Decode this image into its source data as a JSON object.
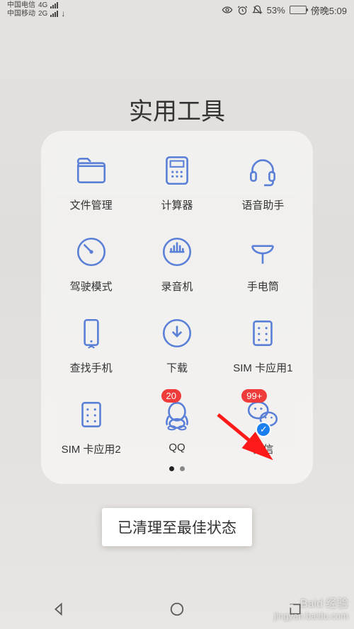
{
  "status": {
    "carrier1": "中国电信",
    "net1": "4G",
    "carrier2": "中国移动",
    "net2": "2G",
    "battery_pct": "53%",
    "time": "傍晚5:09"
  },
  "folder": {
    "title": "实用工具",
    "apps": [
      {
        "id": "files",
        "label": "文件管理",
        "icon": "folder-icon",
        "badge": null,
        "dual": false
      },
      {
        "id": "calc",
        "label": "计算器",
        "icon": "calculator-icon",
        "badge": null,
        "dual": false
      },
      {
        "id": "voice",
        "label": "语音助手",
        "icon": "headset-icon",
        "badge": null,
        "dual": false
      },
      {
        "id": "drive",
        "label": "驾驶模式",
        "icon": "gauge-icon",
        "badge": null,
        "dual": false
      },
      {
        "id": "recorder",
        "label": "录音机",
        "icon": "recorder-icon",
        "badge": null,
        "dual": false
      },
      {
        "id": "torch",
        "label": "手电筒",
        "icon": "torch-icon",
        "badge": null,
        "dual": false
      },
      {
        "id": "findphone",
        "label": "查找手机",
        "icon": "find-phone-icon",
        "badge": null,
        "dual": false
      },
      {
        "id": "download",
        "label": "下载",
        "icon": "download-icon",
        "badge": null,
        "dual": false
      },
      {
        "id": "sim1",
        "label": "SIM 卡应用1",
        "icon": "sim-icon",
        "badge": null,
        "dual": false
      },
      {
        "id": "sim2",
        "label": "SIM 卡应用2",
        "icon": "sim-icon",
        "badge": null,
        "dual": false
      },
      {
        "id": "qq",
        "label": "QQ",
        "icon": "qq-icon",
        "badge": "20",
        "dual": false
      },
      {
        "id": "wechat",
        "label": "微信",
        "icon": "wechat-icon",
        "badge": "99+",
        "dual": true
      }
    ],
    "page_count": 2,
    "active_page": 0
  },
  "toast": {
    "text": "已清理至最佳状态"
  },
  "watermark": {
    "brand": "Baid",
    "brand_suffix": "经验",
    "url": "jingyan.baidu.com"
  },
  "colors": {
    "icon": "#5a7fd6",
    "badge": "#f03b3b",
    "arrow": "#ff1a1a"
  }
}
